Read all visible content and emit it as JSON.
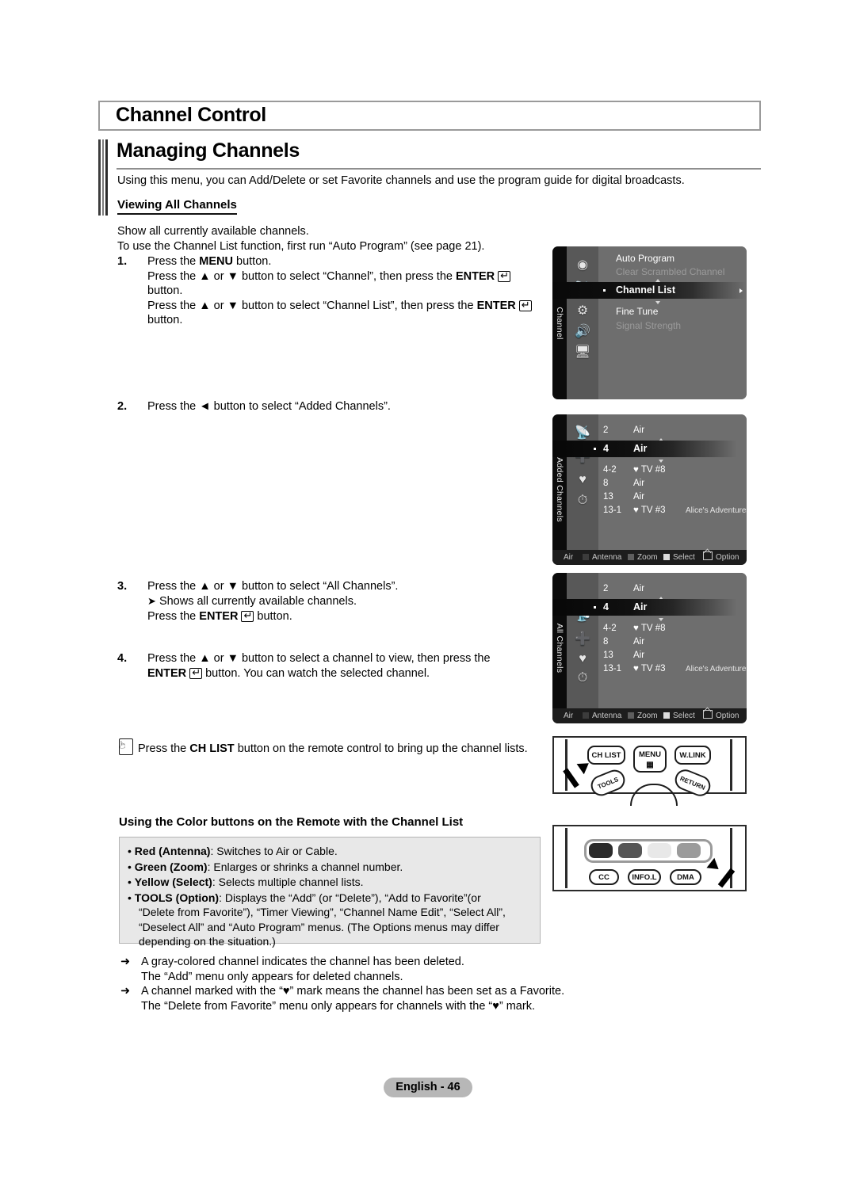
{
  "document": {
    "chapter_title": "Channel Control",
    "section_title": "Managing Channels",
    "intro": "Using this menu, you can Add/Delete or set Favorite channels and use the program guide for digital broadcasts.",
    "subhead": "Viewing All Channels",
    "lead_line1": "Show all currently available channels.",
    "lead_line2": "To use the Channel List function, first run “Auto Program” (see page 21).",
    "footer": "English - 46"
  },
  "steps": [
    {
      "num": "1.",
      "line1_a": "Press the ",
      "line1_b": "MENU",
      "line1_c": " button.",
      "line2_a": "Press the ▲ or ▼ button to select “Channel”, then press the ",
      "line2_b": "ENTER",
      "line2_c": " button.",
      "line3_a": "Press the ▲ or ▼ button to select “Channel List”, then press the ",
      "line3_b": "ENTER",
      "line3_c": " button."
    },
    {
      "num": "2.",
      "line1_a": "Press the ◄ button to select “Added Channels”."
    },
    {
      "num": "3.",
      "line1_a": "Press the ▲ or ▼ button to select “All Channels”.",
      "sub": "Shows all currently available channels.",
      "line3_a": "Press the ",
      "line3_b": "ENTER",
      "line3_c": " button."
    },
    {
      "num": "4.",
      "line1_a": "Press the ▲ or ▼ button to select a channel to view, then press the ",
      "line2_b": "ENTER",
      "line2_c": " button. You can watch the selected channel."
    }
  ],
  "chlist_note": {
    "before": "Press the ",
    "bold": "CH LIST",
    "after": " button on the remote control to bring up the channel lists."
  },
  "color_section": {
    "heading": "Using the Color buttons on the Remote with the Channel List",
    "items": [
      {
        "label": "Red (Antenna)",
        "text": ": Switches to Air or Cable.",
        "cont": []
      },
      {
        "label": "Green (Zoom)",
        "text": ": Enlarges or shrinks a channel number.",
        "cont": []
      },
      {
        "label": "Yellow (Select)",
        "text": ": Selects multiple channel lists.",
        "cont": []
      },
      {
        "label": "TOOLS (Option)",
        "text": ": Displays the “Add” (or “Delete”), “Add to Favorite”(or",
        "cont": [
          "“Delete from Favorite”), “Timer Viewing”, “Channel Name Edit”, “Select All”,",
          "“Deselect All” and “Auto Program” menus. (The Options menus may differ",
          "depending on the situation.)"
        ]
      }
    ]
  },
  "bottom_notes": [
    {
      "mark": "➜",
      "line1": "A gray-colored channel indicates the channel has been deleted.",
      "line2": "The “Add” menu only appears for deleted channels."
    },
    {
      "mark": "➜",
      "line1": "A channel marked with the “♥” mark means the channel has been set as a Favorite.",
      "line2": "The “Delete from Favorite” menu only appears for channels with the “♥” mark."
    }
  ],
  "tv_menu": {
    "rail_label": "Channel",
    "icons": [
      "antenna-dot-icon",
      "satellite-dish-icon",
      "gear-icon",
      "speaker-icon",
      "display-icon"
    ],
    "rows": [
      {
        "label": "Auto Program",
        "state": "normal"
      },
      {
        "label": "Clear Scrambled Channel",
        "state": "dim"
      },
      {
        "label": "Channel List",
        "state": "selected"
      },
      {
        "label": "Fine Tune",
        "state": "normal"
      },
      {
        "label": "Signal Strength",
        "state": "dim"
      }
    ]
  },
  "tv_added": {
    "rail_label": "Added Channels",
    "icons": [
      "antenna-all-icon",
      "add-channel-icon",
      "heart-icon",
      "clock-icon"
    ],
    "rows": [
      {
        "num": "2",
        "src": "Air",
        "name": "",
        "selected": false
      },
      {
        "num": "4",
        "src": "Air",
        "name": "",
        "selected": true
      },
      {
        "num": "4-2",
        "src": "♥ TV #8",
        "name": "",
        "selected": false
      },
      {
        "num": "8",
        "src": "Air",
        "name": "",
        "selected": false
      },
      {
        "num": "13",
        "src": "Air",
        "name": "",
        "selected": false
      },
      {
        "num": "13-1",
        "src": "♥ TV #3",
        "name": "Alice's Adventures in Wonderland",
        "selected": false
      }
    ],
    "footer": {
      "air": "Air",
      "antenna": "Antenna",
      "zoom": "Zoom",
      "select": "Select",
      "option": "Option"
    }
  },
  "tv_all": {
    "rail_label": "All Channels",
    "icons": [
      "antenna-all-icon",
      "add-channel-icon",
      "heart-icon",
      "clock-icon"
    ],
    "rows": [
      {
        "num": "2",
        "src": "Air",
        "name": "",
        "selected": false
      },
      {
        "num": "4",
        "src": "Air",
        "name": "",
        "selected": true
      },
      {
        "num": "4-2",
        "src": "♥ TV #8",
        "name": "",
        "selected": false
      },
      {
        "num": "8",
        "src": "Air",
        "name": "",
        "selected": false
      },
      {
        "num": "13",
        "src": "Air",
        "name": "",
        "selected": false
      },
      {
        "num": "13-1",
        "src": "♥ TV #3",
        "name": "Alice's Adventures in Wonderland",
        "selected": false
      }
    ],
    "footer": {
      "air": "Air",
      "antenna": "Antenna",
      "zoom": "Zoom",
      "select": "Select",
      "option": "Option"
    }
  },
  "remote_top": {
    "buttons": [
      "CH LIST",
      "MENU",
      "W.LINK",
      "TOOLS",
      "RETURN"
    ]
  },
  "remote_bottom": {
    "buttons": [
      "CC",
      "INFO.L",
      "DMA"
    ],
    "color_buttons": [
      "red",
      "green",
      "yellow",
      "blue"
    ]
  },
  "colors": {
    "osd_background": "#6e6e6e",
    "osd_rail": "#0b0b0b",
    "osd_iconcol": "#585858",
    "footer_pill": "#b7b7b7",
    "color_box_bg": "#e8e8e8"
  }
}
